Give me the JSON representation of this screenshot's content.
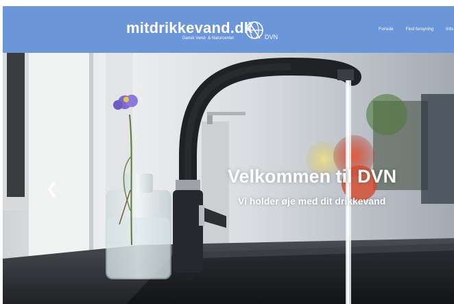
{
  "header": {
    "logo_text": "mitdrikkevand.dk",
    "logo_subtitle": "Dansk Vand- & Naturcenter",
    "logo_badge": "DVN",
    "emblem_icon": "compass-globe-icon"
  },
  "nav": {
    "items": [
      {
        "label": "Forside"
      },
      {
        "label": "Find forsyning"
      },
      {
        "label": "Info"
      }
    ]
  },
  "hero": {
    "title": "Velkommen til DVN",
    "subtitle": "Vi holder øje med dit drikkevand",
    "prev_icon": "chevron-left-icon",
    "slides_total": 2,
    "active_slide": 1
  },
  "colors": {
    "header_bg": "#6b97da",
    "text": "#ffffff"
  }
}
